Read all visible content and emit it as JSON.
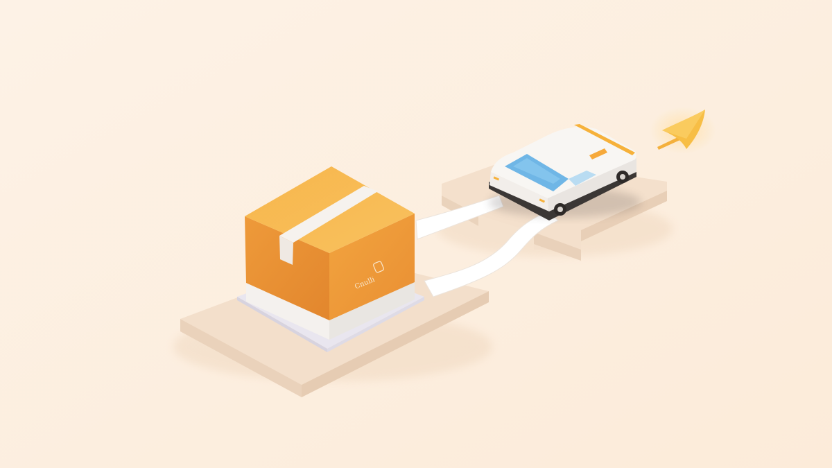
{
  "scene": {
    "box_label": "Cnulli",
    "colors": {
      "background": "#fdf0e2",
      "platform_top": "#f3dfcb",
      "platform_side": "#e8cfb7",
      "box_top": "#f7b84f",
      "box_left": "#ef9c3c",
      "box_right": "#e8943a",
      "tape": "#f5f2ee",
      "road": "#ffffff",
      "car_body": "#f7f4f0",
      "car_window": "#6fb6e6",
      "car_accent": "#f6b13a",
      "arrow": "#f7be45"
    }
  }
}
